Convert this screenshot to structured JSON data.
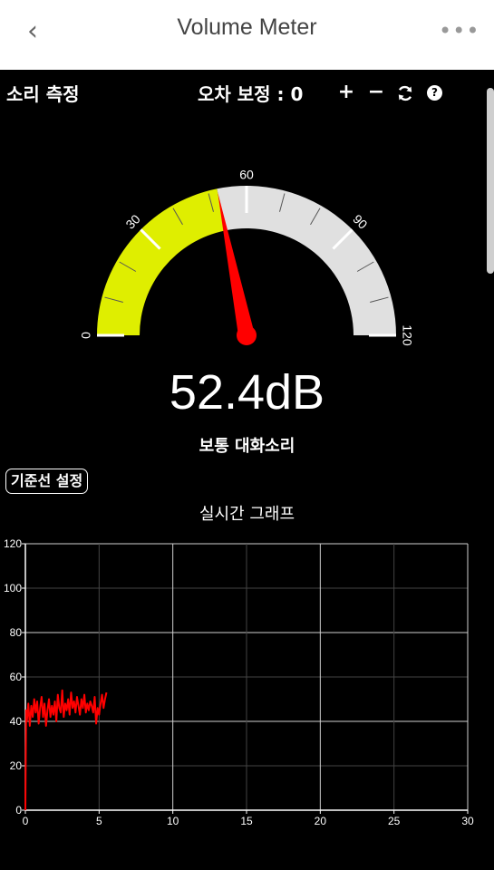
{
  "app": {
    "title": "Volume Meter",
    "back_icon": "chevron-left-icon",
    "menu_icon": "more-horizontal-icon"
  },
  "header": {
    "left_label": "소리 측정",
    "calibration_label": "오차 보정 : 0",
    "plus_label": "+",
    "minus_label": "−",
    "reset_icon": "refresh-icon",
    "help_label": "?"
  },
  "gauge": {
    "ticks": [
      "0",
      "30",
      "60",
      "90",
      "120"
    ],
    "min": 0,
    "max": 120,
    "value": 52.4,
    "colors": {
      "active": "#dfee00",
      "inactive": "#e0e0e0",
      "needle": "#ff0000"
    }
  },
  "reading": {
    "value_text": "52.4dB",
    "level_text": "보통 대화소리"
  },
  "baseline_button": {
    "label": "기준선 설정"
  },
  "graph": {
    "title": "실시간 그래프"
  },
  "chart_data": {
    "type": "line",
    "title": "실시간 그래프",
    "xlim": [
      0,
      30
    ],
    "ylim": [
      0,
      120
    ],
    "xticks": [
      0,
      5,
      10,
      15,
      20,
      25,
      30
    ],
    "yticks": [
      0,
      20,
      40,
      60,
      80,
      100,
      120
    ],
    "grid": true,
    "series": [
      {
        "color": "#ff0000",
        "x": [
          0,
          0.05,
          0.1,
          0.2,
          0.3,
          0.4,
          0.5,
          0.6,
          0.7,
          0.8,
          0.9,
          1.0,
          1.1,
          1.2,
          1.3,
          1.4,
          1.5,
          1.6,
          1.7,
          1.8,
          1.9,
          2.0,
          2.1,
          2.2,
          2.3,
          2.4,
          2.5,
          2.6,
          2.7,
          2.8,
          2.9,
          3.0,
          3.1,
          3.2,
          3.3,
          3.4,
          3.5,
          3.6,
          3.7,
          3.8,
          3.9,
          4.0,
          4.1,
          4.2,
          4.3,
          4.4,
          4.5,
          4.6,
          4.7,
          4.8,
          4.9,
          5.0,
          5.1,
          5.2,
          5.3,
          5.4,
          5.5
        ],
        "y": [
          0,
          45,
          40,
          48,
          38,
          47,
          42,
          50,
          44,
          49,
          39,
          46,
          51,
          42,
          48,
          38,
          45,
          50,
          42,
          47,
          43,
          49,
          40,
          52,
          46,
          44,
          54,
          42,
          48,
          45,
          50,
          43,
          53,
          46,
          49,
          44,
          51,
          47,
          43,
          50,
          46,
          52,
          44,
          48,
          45,
          49,
          47,
          44,
          51,
          39,
          46,
          43,
          48,
          52,
          46,
          50,
          53
        ]
      }
    ]
  }
}
